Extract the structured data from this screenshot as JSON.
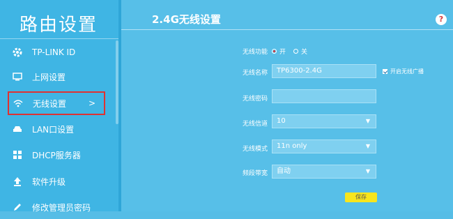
{
  "sidebar": {
    "brand": "路由设置",
    "items": [
      {
        "label": "TP-LINK ID",
        "icon": "gear-icon"
      },
      {
        "label": "上网设置",
        "icon": "monitor-icon"
      },
      {
        "label": "无线设置",
        "icon": "wifi-icon",
        "active": true,
        "chevron": ">"
      },
      {
        "label": "LAN口设置",
        "icon": "car-icon"
      },
      {
        "label": "DHCP服务器",
        "icon": "dhcp-icon"
      },
      {
        "label": "软件升级",
        "icon": "upload-icon"
      },
      {
        "label": "修改管理员密码",
        "icon": "pencil-icon"
      }
    ]
  },
  "main": {
    "title": "2.4G无线设置",
    "help": "?",
    "wireless_switch": {
      "label": "无线功能",
      "on": "开",
      "off": "关",
      "selected": "on"
    },
    "ssid": {
      "label": "无线名称",
      "value": "TP6300-2.4G"
    },
    "broadcast": {
      "label": "开启无线广播",
      "checked": true
    },
    "password": {
      "label": "无线密码",
      "value": ""
    },
    "channel": {
      "label": "无线信道",
      "value": "10"
    },
    "mode": {
      "label": "无线模式",
      "value": "11n only"
    },
    "bandwidth": {
      "label": "频段带宽",
      "value": "自动"
    },
    "save": "保存"
  },
  "colors": {
    "accent": "#3fb5e4",
    "highlight_border": "#e03131",
    "save_button": "#f8e51d"
  }
}
